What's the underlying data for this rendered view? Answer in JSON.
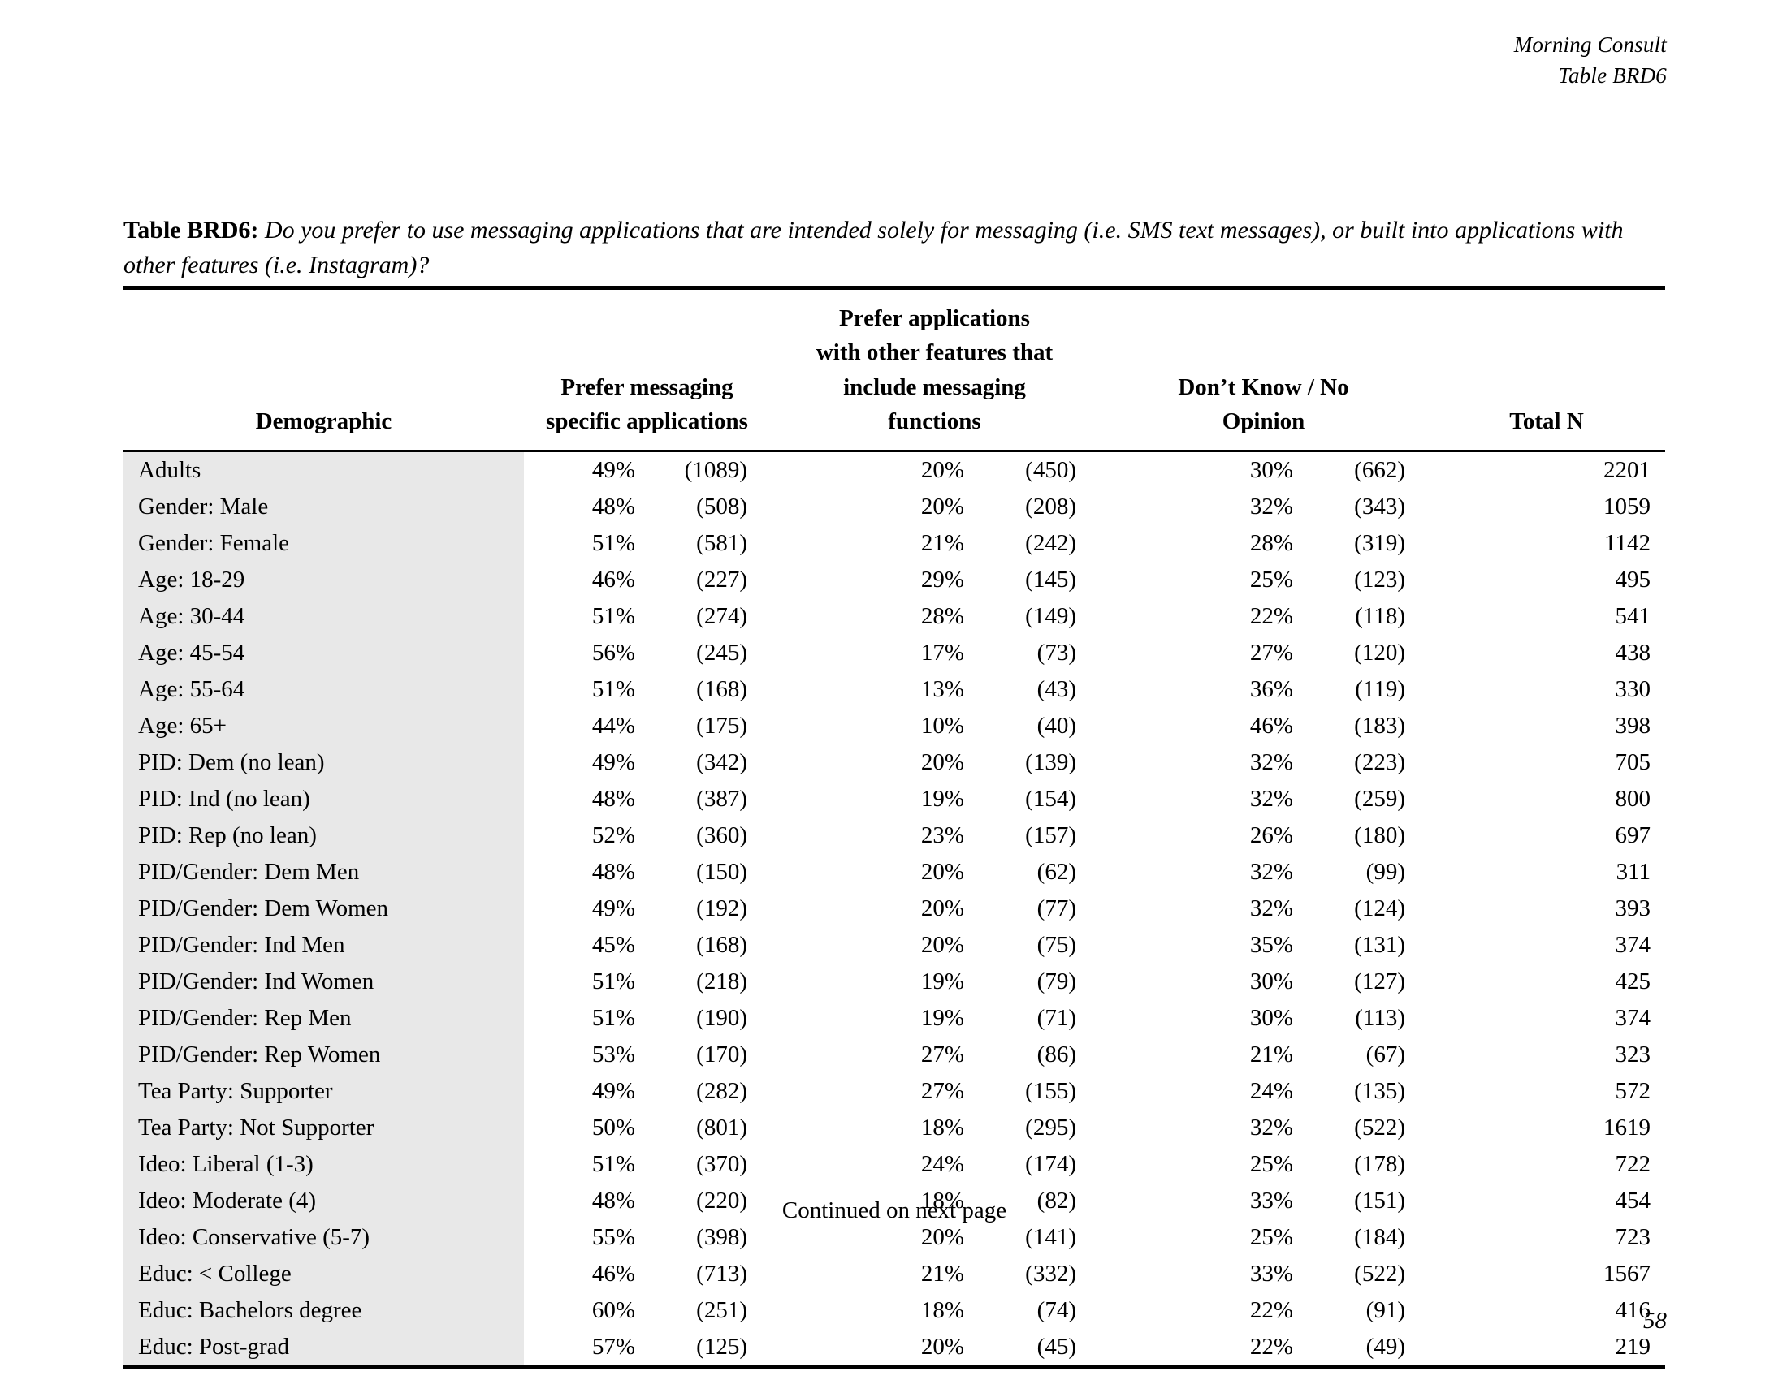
{
  "header": {
    "organization": "Morning Consult",
    "table_ref": "Table BRD6"
  },
  "caption": {
    "label": "Table BRD6:",
    "question": "Do you prefer to use messaging applications that are intended solely for messaging (i.e. SMS text messages), or built into applications with other features (i.e. Instagram)?"
  },
  "table": {
    "columns": {
      "demographic": "Demographic",
      "col1_line1": "Prefer messaging",
      "col1_line2": "specific applications",
      "col2_line1": "Prefer applications",
      "col2_line2": "with other features that",
      "col2_line3": "include messaging",
      "col2_line4": "functions",
      "col3_line1": "Don’t Know / No",
      "col3_line2": "Opinion",
      "col4": "Total N"
    },
    "rows": [
      {
        "demographic": "Adults",
        "p1": "49%",
        "n1": "(1089)",
        "p2": "20%",
        "n2": "(450)",
        "p3": "30%",
        "n3": "(662)",
        "total": "2201"
      },
      {
        "demographic": "Gender: Male",
        "p1": "48%",
        "n1": "(508)",
        "p2": "20%",
        "n2": "(208)",
        "p3": "32%",
        "n3": "(343)",
        "total": "1059"
      },
      {
        "demographic": "Gender: Female",
        "p1": "51%",
        "n1": "(581)",
        "p2": "21%",
        "n2": "(242)",
        "p3": "28%",
        "n3": "(319)",
        "total": "1142"
      },
      {
        "demographic": "Age: 18-29",
        "p1": "46%",
        "n1": "(227)",
        "p2": "29%",
        "n2": "(145)",
        "p3": "25%",
        "n3": "(123)",
        "total": "495"
      },
      {
        "demographic": "Age: 30-44",
        "p1": "51%",
        "n1": "(274)",
        "p2": "28%",
        "n2": "(149)",
        "p3": "22%",
        "n3": "(118)",
        "total": "541"
      },
      {
        "demographic": "Age: 45-54",
        "p1": "56%",
        "n1": "(245)",
        "p2": "17%",
        "n2": "(73)",
        "p3": "27%",
        "n3": "(120)",
        "total": "438"
      },
      {
        "demographic": "Age: 55-64",
        "p1": "51%",
        "n1": "(168)",
        "p2": "13%",
        "n2": "(43)",
        "p3": "36%",
        "n3": "(119)",
        "total": "330"
      },
      {
        "demographic": "Age: 65+",
        "p1": "44%",
        "n1": "(175)",
        "p2": "10%",
        "n2": "(40)",
        "p3": "46%",
        "n3": "(183)",
        "total": "398"
      },
      {
        "demographic": "PID: Dem (no lean)",
        "p1": "49%",
        "n1": "(342)",
        "p2": "20%",
        "n2": "(139)",
        "p3": "32%",
        "n3": "(223)",
        "total": "705"
      },
      {
        "demographic": "PID: Ind (no lean)",
        "p1": "48%",
        "n1": "(387)",
        "p2": "19%",
        "n2": "(154)",
        "p3": "32%",
        "n3": "(259)",
        "total": "800"
      },
      {
        "demographic": "PID: Rep (no lean)",
        "p1": "52%",
        "n1": "(360)",
        "p2": "23%",
        "n2": "(157)",
        "p3": "26%",
        "n3": "(180)",
        "total": "697"
      },
      {
        "demographic": "PID/Gender: Dem Men",
        "p1": "48%",
        "n1": "(150)",
        "p2": "20%",
        "n2": "(62)",
        "p3": "32%",
        "n3": "(99)",
        "total": "311"
      },
      {
        "demographic": "PID/Gender: Dem Women",
        "p1": "49%",
        "n1": "(192)",
        "p2": "20%",
        "n2": "(77)",
        "p3": "32%",
        "n3": "(124)",
        "total": "393"
      },
      {
        "demographic": "PID/Gender: Ind Men",
        "p1": "45%",
        "n1": "(168)",
        "p2": "20%",
        "n2": "(75)",
        "p3": "35%",
        "n3": "(131)",
        "total": "374"
      },
      {
        "demographic": "PID/Gender: Ind Women",
        "p1": "51%",
        "n1": "(218)",
        "p2": "19%",
        "n2": "(79)",
        "p3": "30%",
        "n3": "(127)",
        "total": "425"
      },
      {
        "demographic": "PID/Gender: Rep Men",
        "p1": "51%",
        "n1": "(190)",
        "p2": "19%",
        "n2": "(71)",
        "p3": "30%",
        "n3": "(113)",
        "total": "374"
      },
      {
        "demographic": "PID/Gender: Rep Women",
        "p1": "53%",
        "n1": "(170)",
        "p2": "27%",
        "n2": "(86)",
        "p3": "21%",
        "n3": "(67)",
        "total": "323"
      },
      {
        "demographic": "Tea Party: Supporter",
        "p1": "49%",
        "n1": "(282)",
        "p2": "27%",
        "n2": "(155)",
        "p3": "24%",
        "n3": "(135)",
        "total": "572"
      },
      {
        "demographic": "Tea Party: Not Supporter",
        "p1": "50%",
        "n1": "(801)",
        "p2": "18%",
        "n2": "(295)",
        "p3": "32%",
        "n3": "(522)",
        "total": "1619"
      },
      {
        "demographic": "Ideo: Liberal (1-3)",
        "p1": "51%",
        "n1": "(370)",
        "p2": "24%",
        "n2": "(174)",
        "p3": "25%",
        "n3": "(178)",
        "total": "722"
      },
      {
        "demographic": "Ideo: Moderate (4)",
        "p1": "48%",
        "n1": "(220)",
        "p2": "18%",
        "n2": "(82)",
        "p3": "33%",
        "n3": "(151)",
        "total": "454"
      },
      {
        "demographic": "Ideo: Conservative (5-7)",
        "p1": "55%",
        "n1": "(398)",
        "p2": "20%",
        "n2": "(141)",
        "p3": "25%",
        "n3": "(184)",
        "total": "723"
      },
      {
        "demographic": "Educ: < College",
        "p1": "46%",
        "n1": "(713)",
        "p2": "21%",
        "n2": "(332)",
        "p3": "33%",
        "n3": "(522)",
        "total": "1567"
      },
      {
        "demographic": "Educ: Bachelors degree",
        "p1": "60%",
        "n1": "(251)",
        "p2": "18%",
        "n2": "(74)",
        "p3": "22%",
        "n3": "(91)",
        "total": "416"
      },
      {
        "demographic": "Educ: Post-grad",
        "p1": "57%",
        "n1": "(125)",
        "p2": "20%",
        "n2": "(45)",
        "p3": "22%",
        "n3": "(49)",
        "total": "219"
      }
    ]
  },
  "footer": {
    "continued": "Continued on next page",
    "page_number": "58"
  },
  "colors": {
    "shade": "#e8e8e8",
    "rule": "#000000",
    "text": "#000000"
  }
}
